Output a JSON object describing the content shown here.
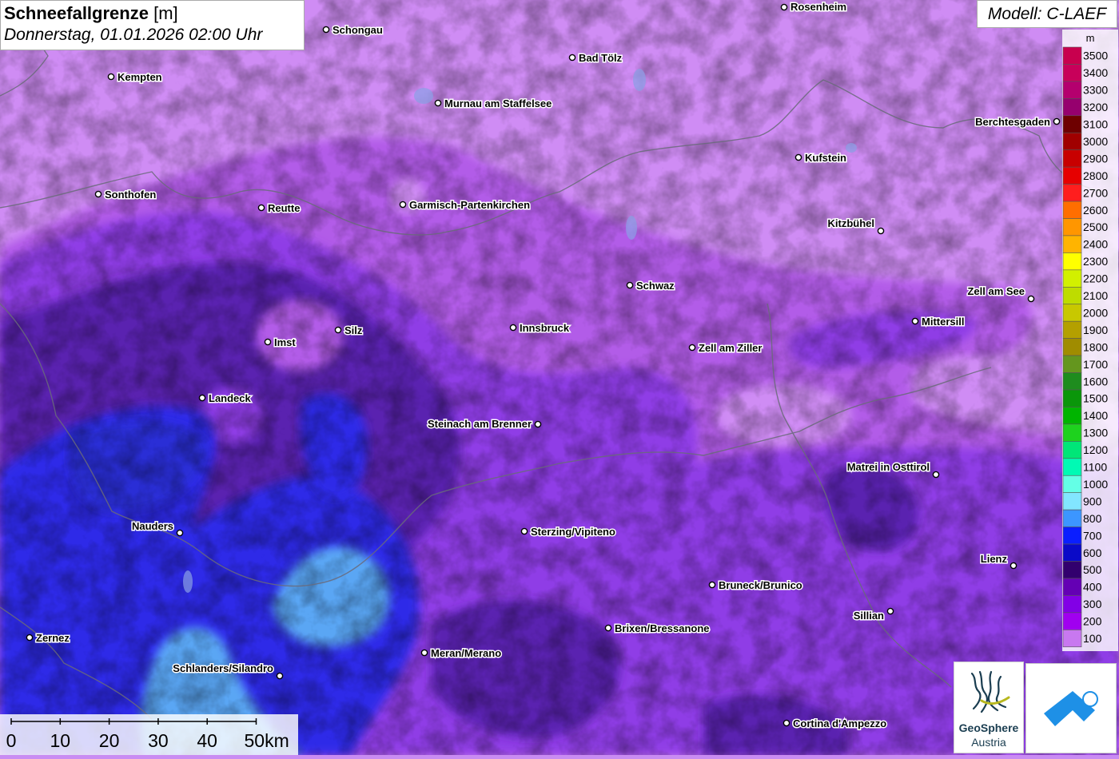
{
  "header": {
    "title": "Schneefallgrenze",
    "unit": "[m]",
    "datetime": "Donnerstag, 01.01.2026 02:00 Uhr"
  },
  "model_label": "Modell: C-LAEF",
  "legend": {
    "unit": "m",
    "levels": [
      {
        "value": "3500",
        "color": "#c8004e"
      },
      {
        "value": "3400",
        "color": "#c8005a"
      },
      {
        "value": "3300",
        "color": "#b4006e"
      },
      {
        "value": "3200",
        "color": "#96006e"
      },
      {
        "value": "3100",
        "color": "#6e0000"
      },
      {
        "value": "3000",
        "color": "#a00000"
      },
      {
        "value": "2900",
        "color": "#c80000"
      },
      {
        "value": "2800",
        "color": "#e60000"
      },
      {
        "value": "2700",
        "color": "#ff1e1e"
      },
      {
        "value": "2600",
        "color": "#ff6e00"
      },
      {
        "value": "2500",
        "color": "#ff9600"
      },
      {
        "value": "2400",
        "color": "#ffb400"
      },
      {
        "value": "2300",
        "color": "#ffff00"
      },
      {
        "value": "2200",
        "color": "#d2f000"
      },
      {
        "value": "2100",
        "color": "#bedc00"
      },
      {
        "value": "2000",
        "color": "#c8c800"
      },
      {
        "value": "1900",
        "color": "#b4a000"
      },
      {
        "value": "1800",
        "color": "#a08c00"
      },
      {
        "value": "1700",
        "color": "#64961e"
      },
      {
        "value": "1600",
        "color": "#1e8c1e"
      },
      {
        "value": "1500",
        "color": "#0a960a"
      },
      {
        "value": "1400",
        "color": "#00b400"
      },
      {
        "value": "1300",
        "color": "#1ed21e"
      },
      {
        "value": "1200",
        "color": "#00e678"
      },
      {
        "value": "1100",
        "color": "#00fab4"
      },
      {
        "value": "1000",
        "color": "#64ffe6"
      },
      {
        "value": "900",
        "color": "#82e6ff"
      },
      {
        "value": "800",
        "color": "#3c96ff"
      },
      {
        "value": "700",
        "color": "#0a1eff"
      },
      {
        "value": "600",
        "color": "#0a0ac8"
      },
      {
        "value": "500",
        "color": "#32006e"
      },
      {
        "value": "400",
        "color": "#6400b4"
      },
      {
        "value": "300",
        "color": "#8200e6"
      },
      {
        "value": "200",
        "color": "#a000f0"
      },
      {
        "value": "100",
        "color": "#c878f0"
      }
    ]
  },
  "scale_bar": {
    "ticks": [
      "0",
      "10",
      "20",
      "30",
      "40",
      "50km"
    ]
  },
  "logos": {
    "geosphere_line1": "GeoSphere",
    "geosphere_line2": "Austria"
  },
  "cities": [
    {
      "name": "Rosenheim"
    },
    {
      "name": "Schongau"
    },
    {
      "name": "Bad Tölz"
    },
    {
      "name": "Kempten"
    },
    {
      "name": "Murnau am Staffelsee"
    },
    {
      "name": "Berchtesgaden"
    },
    {
      "name": "Kufstein"
    },
    {
      "name": "Sonthofen"
    },
    {
      "name": "Reutte"
    },
    {
      "name": "Garmisch-Partenkirchen"
    },
    {
      "name": "Kitzbühel"
    },
    {
      "name": "Schwaz"
    },
    {
      "name": "Zell am See"
    },
    {
      "name": "Mittersill"
    },
    {
      "name": "Innsbruck"
    },
    {
      "name": "Imst"
    },
    {
      "name": "Silz"
    },
    {
      "name": "Zell am Ziller"
    },
    {
      "name": "Landeck"
    },
    {
      "name": "Steinach am Brenner"
    },
    {
      "name": "Matrei in Osttirol"
    },
    {
      "name": "Nauders"
    },
    {
      "name": "Sterzing/Vipiteno"
    },
    {
      "name": "Lienz"
    },
    {
      "name": "Bruneck/Brunico"
    },
    {
      "name": "Sillian"
    },
    {
      "name": "Brixen/Bressanone"
    },
    {
      "name": "Zernez"
    },
    {
      "name": "Meran/Merano"
    },
    {
      "name": "Schlanders/Silandro"
    },
    {
      "name": "Cortina d'Ampezzo"
    }
  ]
}
